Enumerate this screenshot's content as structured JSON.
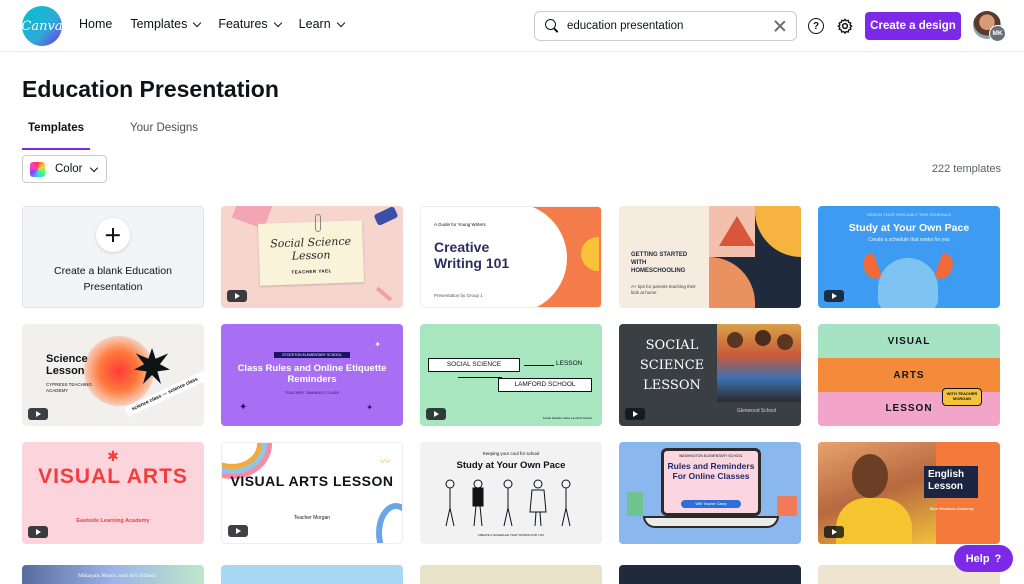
{
  "app": {
    "logo_text": "Canva"
  },
  "nav": {
    "home": "Home",
    "templates": "Templates",
    "features": "Features",
    "learn": "Learn"
  },
  "search": {
    "value": "education presentation"
  },
  "header": {
    "create_label": "Create a design",
    "help_glyph": "?",
    "avatar_initials": "MK"
  },
  "page": {
    "title": "Education Presentation"
  },
  "tabs": {
    "templates": "Templates",
    "your_designs": "Your Designs"
  },
  "filter": {
    "color_label": "Color"
  },
  "results": {
    "count": "222 templates"
  },
  "blank_card": {
    "label": "Create a blank Education Presentation"
  },
  "cards": [
    {
      "title": "Social Science Lesson",
      "sub": "TEACHER YAEL"
    },
    {
      "kicker": "A Guide for Young Writers",
      "title": "Creative Writing 101",
      "foot": "Presentation by Group 1"
    },
    {
      "title": "GETTING STARTED WITH HOMESCHOOLING",
      "sub": "A+ tips for parents teaching their kids at home"
    },
    {
      "kicker": "DESIGN YOUR OWN DAILY TIME SCHEDULE",
      "title": "Study at Your Own Pace",
      "sub": "Create a schedule that works for you"
    },
    {
      "title": "Science Lesson",
      "sub": "CYPRESS TEACHING ACADEMY",
      "ribbon": "science class — science class"
    },
    {
      "kicker": "STOCKTON ELEMENTARY SCHOOL",
      "title": "Class Rules and Online Etiquette Reminders",
      "sub": "TEACHER TAMARA'S CLASS"
    },
    {
      "title1": "SOCIAL SCIENCE",
      "title2": "LESSON",
      "title3": "LAMFORD SCHOOL",
      "foot": "Social Studies Class Lamford School"
    },
    {
      "title": "SOCIAL SCIENCE LESSON",
      "sub": "Glenwood School"
    },
    {
      "line1": "VISUAL",
      "line2": "ARTS",
      "line3": "LESSON",
      "badge": "WITH TEACHER MORGAN"
    },
    {
      "title": "VISUAL ARTS",
      "sub": "Eastside Learning Academy"
    },
    {
      "title": "VISUAL ARTS LESSON",
      "sub": "Teacher Morgan"
    },
    {
      "kicker": "Keeping your cool for school",
      "title": "Study at Your Own Pace",
      "foot": "CREATE A SCHEDULE THAT WORKS FOR YOU"
    },
    {
      "kicker": "WASHINGTON ELEMENTARY SCHOOL",
      "title": "Rules and Reminders For Online Classes",
      "sub": "With Teacher Casey"
    },
    {
      "title": "English Lesson",
      "sub": "Blue Meadows Academy"
    }
  ],
  "partial_row": {
    "card1": "Mikayan Music and Art School"
  },
  "help": {
    "label": "Help",
    "glyph": "?"
  },
  "colors": {
    "brand_purple": "#7d2ae8",
    "logo_teal": "#00c4cc"
  }
}
